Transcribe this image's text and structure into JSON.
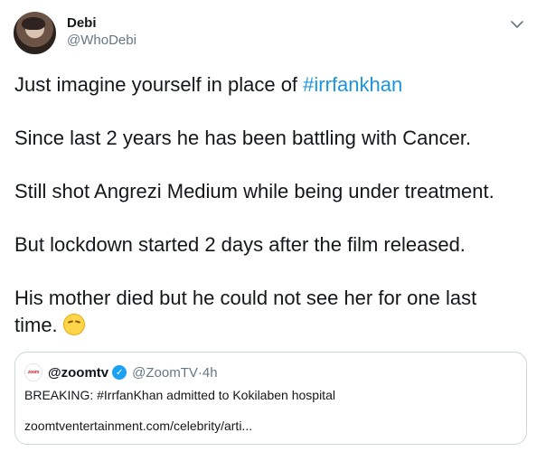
{
  "author": {
    "display_name": "Debi",
    "handle": "@WhoDebi",
    "avatar_icon": "profile-photo"
  },
  "tweet": {
    "line1_prefix": "Just imagine yourself in place of ",
    "line1_hashtag": "#irrfankhan",
    "line2": "Since last 2 years he has been battling with Cancer.",
    "line3": "Still shot Angrezi Medium while being under treatment.",
    "line4": "But lockdown started 2 days after the film released.",
    "line5a": "His mother died but he could not see her for one last",
    "line5b": "time. ",
    "emoji_icon": "pensive-face"
  },
  "quoted": {
    "logo_text": "zoom",
    "name": "@zoomtv",
    "verified_icon": "verified-badge",
    "handle": "@ZoomTV",
    "separator": " · ",
    "time": "4h",
    "text": "BREAKING: #IrrfanKhan admitted to Kokilaben hospital",
    "link": "zoomtventertainment.com/celebrity/arti..."
  },
  "menu": {
    "caret_icon": "chevron-down-icon"
  },
  "colors": {
    "text": "#14171a",
    "secondary": "#657786",
    "link": "#1b95e0",
    "border": "#ccd6dd",
    "verified": "#1da1f2"
  }
}
